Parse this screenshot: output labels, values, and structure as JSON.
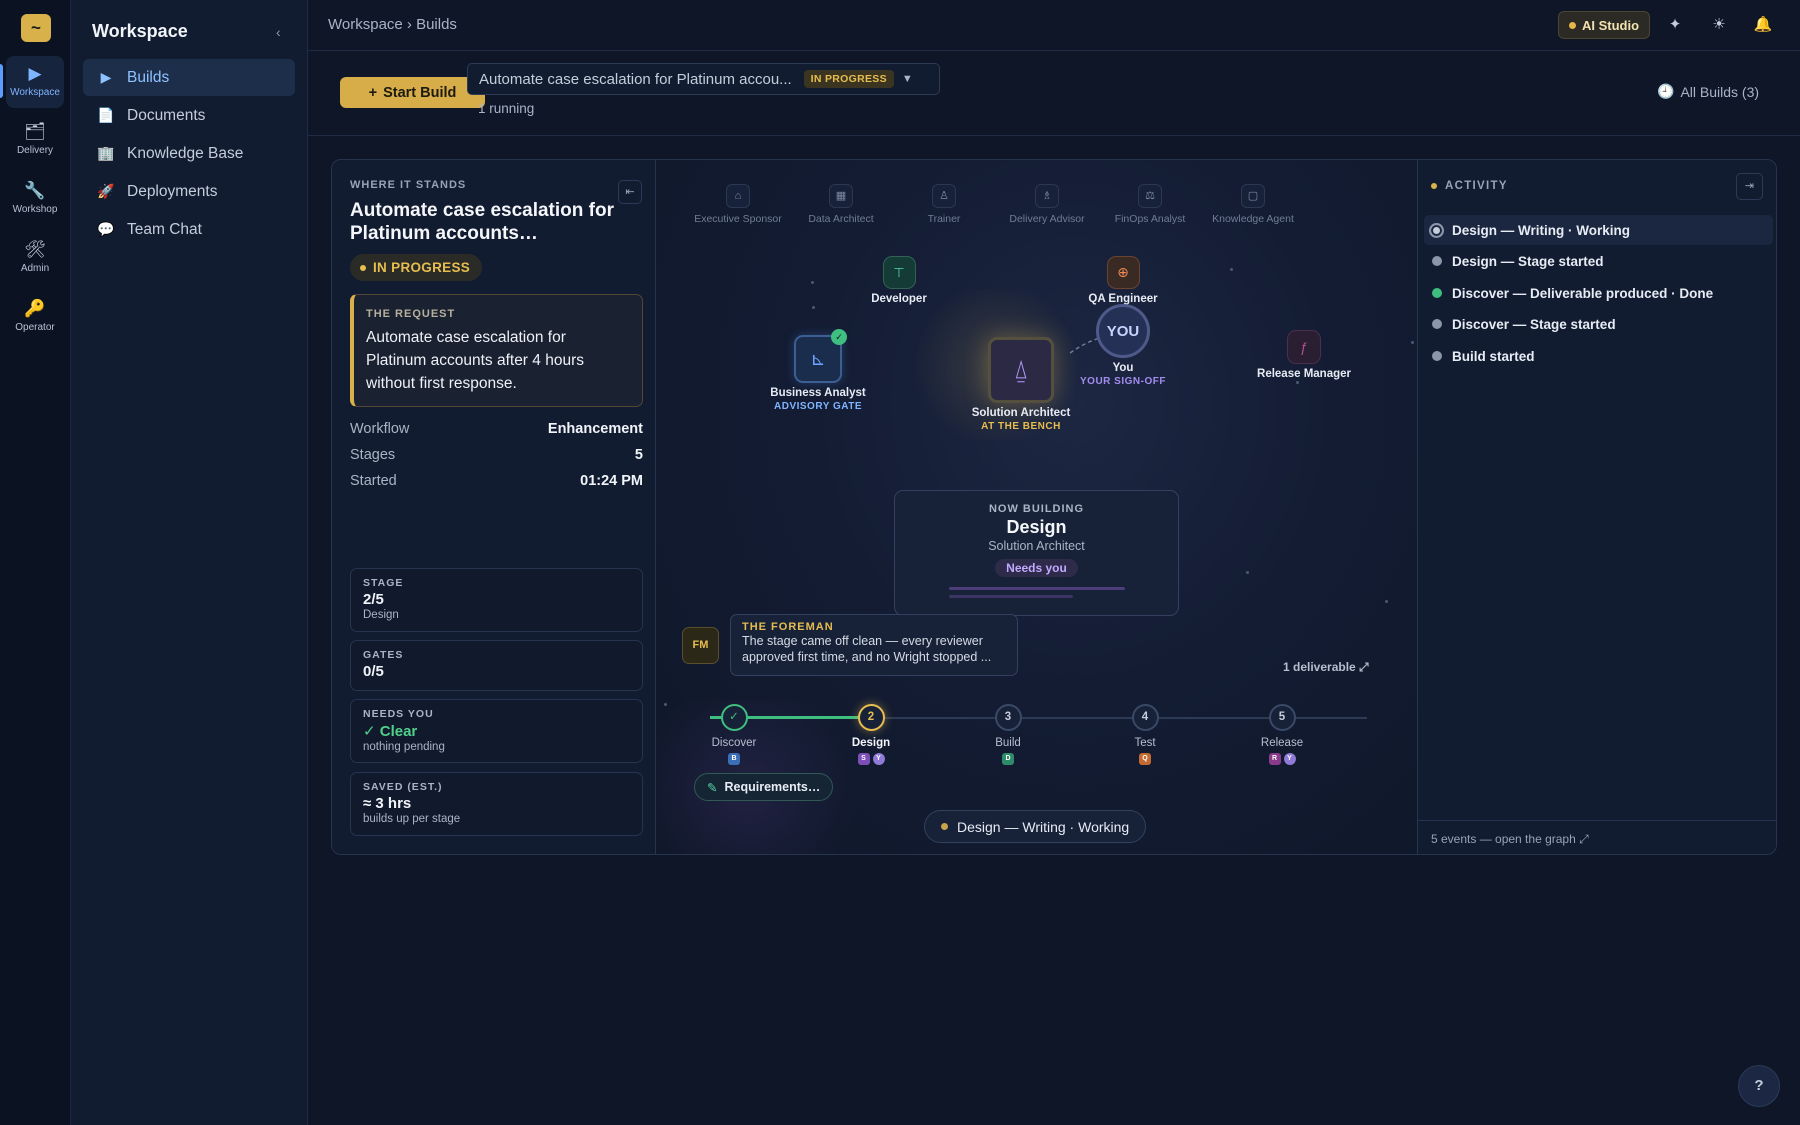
{
  "rail": {
    "logo": "~",
    "items": [
      {
        "icon": "▶",
        "label": "Workspace"
      },
      {
        "icon": "🗂",
        "label": "Delivery"
      },
      {
        "icon": "🔧",
        "label": "Workshop"
      },
      {
        "icon": "🛠",
        "label": "Admin"
      },
      {
        "icon": "🔑",
        "label": "Operator"
      }
    ]
  },
  "sidebar": {
    "title": "Workspace",
    "collapse_icon": "‹",
    "items": [
      {
        "icon": "▶",
        "label": "Builds"
      },
      {
        "icon": "📄",
        "label": "Documents"
      },
      {
        "icon": "🏢",
        "label": "Knowledge Base"
      },
      {
        "icon": "🚀",
        "label": "Deployments"
      },
      {
        "icon": "💬",
        "label": "Team Chat"
      }
    ]
  },
  "topbar": {
    "breadcrumb": "Workspace › Builds",
    "ai_studio": "AI Studio",
    "icons": {
      "sparkle": "✦",
      "theme": "☀",
      "bell": "🔔"
    }
  },
  "buildbar": {
    "start_label": "Start Build",
    "start_icon": "+",
    "selected_build": "Automate case escalation for Platinum accou...",
    "selected_status": "IN PROGRESS",
    "caret": "▼",
    "running": "1 running",
    "all_builds_icon": "🕘",
    "all_builds": "All Builds (3)"
  },
  "left_panel": {
    "eyebrow": "WHERE IT STANDS",
    "collapse_icon": "⇤",
    "title": "Automate case escalation for Platinum accounts…",
    "status": "IN PROGRESS",
    "request_label": "THE REQUEST",
    "request_text": "Automate case escalation for Platinum accounts after 4 hours without first response.",
    "meta": [
      {
        "k": "Workflow",
        "v": "Enhancement"
      },
      {
        "k": "Stages",
        "v": "5"
      },
      {
        "k": "Started",
        "v": "01:24 PM"
      }
    ],
    "stats": [
      {
        "k": "STAGE",
        "v": "2/5",
        "s": "Design"
      },
      {
        "k": "GATES",
        "v": "0/5",
        "s": ""
      },
      {
        "k": "NEEDS YOU",
        "v": "✓ Clear",
        "s": "nothing pending"
      },
      {
        "k": "SAVED (EST.)",
        "v": "≈ 3 hrs",
        "s": "builds up per stage"
      }
    ]
  },
  "canvas": {
    "bench": [
      "Executive Sponsor",
      "Data Architect",
      "Trainer",
      "Delivery Advisor",
      "FinOps Analyst",
      "Knowledge Agent"
    ],
    "bench_icons": [
      "⌂",
      "▦",
      "♙",
      "♗",
      "⚖",
      "▢"
    ],
    "nodes": {
      "developer": {
        "label": "Developer",
        "icon": "⊤"
      },
      "qa": {
        "label": "QA Engineer",
        "icon": "⊕"
      },
      "ba": {
        "label": "Business Analyst",
        "sub": "ADVISORY GATE",
        "icon": "⊾",
        "check": "✓"
      },
      "sa": {
        "label": "Solution Architect",
        "sub": "AT THE BENCH",
        "icon": "⍙"
      },
      "you": {
        "avatar": "YOU",
        "label": "You",
        "sub": "YOUR SIGN-OFF"
      },
      "rm": {
        "label": "Release Manager",
        "icon": "ƒ"
      }
    },
    "now_building": {
      "eyebrow": "NOW BUILDING",
      "stage": "Design",
      "agent": "Solution Architect",
      "pill": "Needs you"
    },
    "foreman": {
      "avatar": "FM",
      "title": "THE FOREMAN",
      "text": "The stage came off clean — every reviewer approved first time, and no Wright stopped ..."
    },
    "deliverable": "1 deliverable ⤢",
    "stages": [
      {
        "num": "✓",
        "label": "Discover",
        "chips": [
          "B"
        ]
      },
      {
        "num": "2",
        "label": "Design",
        "chips": [
          "S",
          "Y"
        ]
      },
      {
        "num": "3",
        "label": "Build",
        "chips": [
          "D"
        ]
      },
      {
        "num": "4",
        "label": "Test",
        "chips": [
          "Q"
        ]
      },
      {
        "num": "5",
        "label": "Release",
        "chips": [
          "R",
          "Y"
        ]
      }
    ],
    "requirements": "Requirements…",
    "requirements_icon": "✎",
    "status": "Design — Writing · Working"
  },
  "activity": {
    "title": "ACTIVITY",
    "collapse_icon": "⇥",
    "items": [
      "Design — Writing · Working",
      "Design — Stage started",
      "Discover — Deliverable produced · Done",
      "Discover — Stage started",
      "Build started"
    ],
    "footer": "5 events — open the graph ⤢"
  },
  "help": "?",
  "colors": {
    "accent": "#d9b14a",
    "primary": "#5b9dff",
    "success": "#3fbf7f",
    "purple": "#c2a8ff"
  }
}
